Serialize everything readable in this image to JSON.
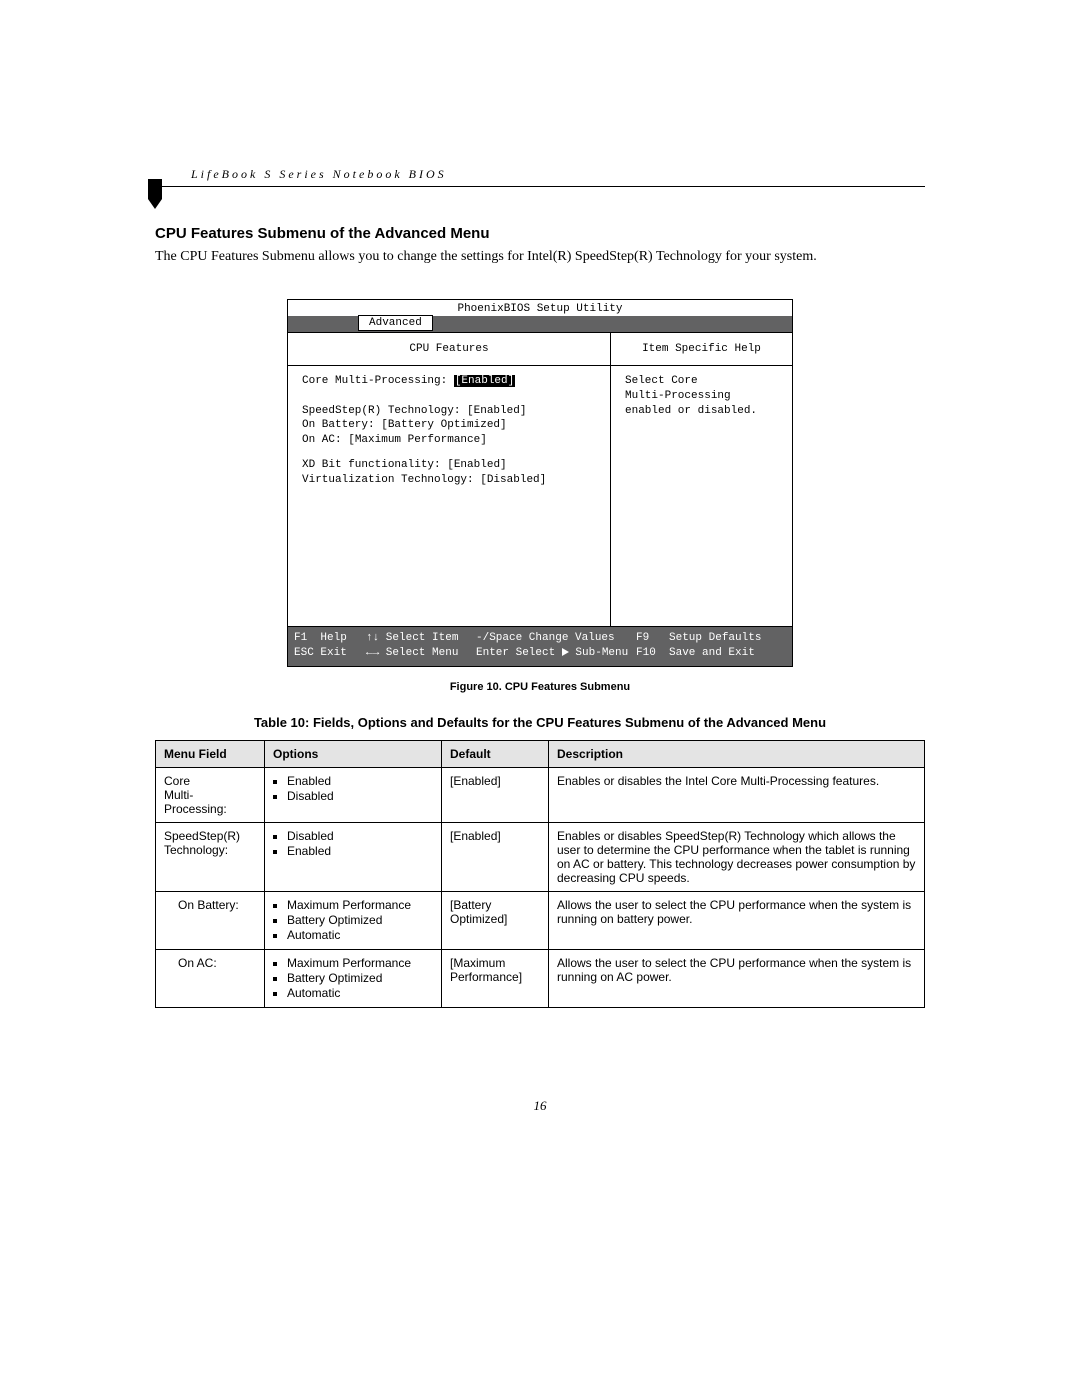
{
  "header": "LifeBook S Series Notebook BIOS",
  "section_title": "CPU Features Submenu of the Advanced Menu",
  "intro": "The CPU Features Submenu allows you to change the settings for Intel(R) SpeedStep(R) Technology for your system.",
  "bios": {
    "utility_title": "PhoenixBIOS Setup Utility",
    "menu_tab": "Advanced",
    "left_title": "CPU Features",
    "right_title": "Item Specific Help",
    "settings": {
      "core_label": "Core Multi-Processing:",
      "core_value": "[Enabled]",
      "speedstep_label": "SpeedStep(R) Technology:",
      "speedstep_value": "[Enabled]",
      "onbatt_label": "On Battery:",
      "onbatt_value": "[Battery Optimized]",
      "onac_label": "On AC:",
      "onac_value": "[Maximum Performance]",
      "xd_label": "XD Bit functionality:",
      "xd_value": "[Enabled]",
      "vt_label": "Virtualization Technology:",
      "vt_value": "[Disabled]"
    },
    "help_text": "Select Core\nMulti-Processing\nenabled or disabled.",
    "footer": {
      "f1": "F1",
      "help": "Help",
      "arrows_v": "↑↓",
      "select_item": "Select Item",
      "minus_space": "-/Space",
      "change_values": "Change Values",
      "f9": "F9",
      "setup_defaults": "Setup Defaults",
      "esc": "ESC",
      "exit": "Exit",
      "arrows_h": "←→",
      "select_menu": "Select Menu",
      "enter": "Enter",
      "select_sub": "Select",
      "submenu": "Sub-Menu",
      "f10": "F10",
      "save_exit": "Save and Exit"
    }
  },
  "figure_caption": "Figure 10.   CPU Features Submenu",
  "table_caption": "Table 10: Fields, Options and Defaults for the CPU Features Submenu of the Advanced Menu",
  "table": {
    "headers": [
      "Menu Field",
      "Options",
      "Default",
      "Description"
    ],
    "rows": [
      {
        "field": "Core\nMulti-Processing:",
        "options": [
          "Enabled",
          "Disabled"
        ],
        "default": "[Enabled]",
        "desc": "Enables or disables the Intel Core Multi-Processing features."
      },
      {
        "field": "SpeedStep(R)\nTechnology:",
        "options": [
          "Disabled",
          "Enabled"
        ],
        "default": "[Enabled]",
        "desc": "Enables or disables SpeedStep(R) Technology which allows the user to determine the CPU performance when the tablet is running on AC or battery. This technology decreases power consumption by decreasing CPU speeds."
      },
      {
        "field": "On Battery:",
        "indent": true,
        "options": [
          "Maximum Performance",
          "Battery Optimized",
          "Automatic"
        ],
        "default": "[Battery\nOptimized]",
        "desc": "Allows the user to select the CPU performance when the system is running on battery power."
      },
      {
        "field": "On AC:",
        "indent": true,
        "options": [
          "Maximum Performance",
          "Battery Optimized",
          "Automatic"
        ],
        "default": "[Maximum\nPerformance]",
        "desc": "Allows the user to select the CPU performance when the system is running on AC power."
      }
    ]
  },
  "page_number": "16"
}
